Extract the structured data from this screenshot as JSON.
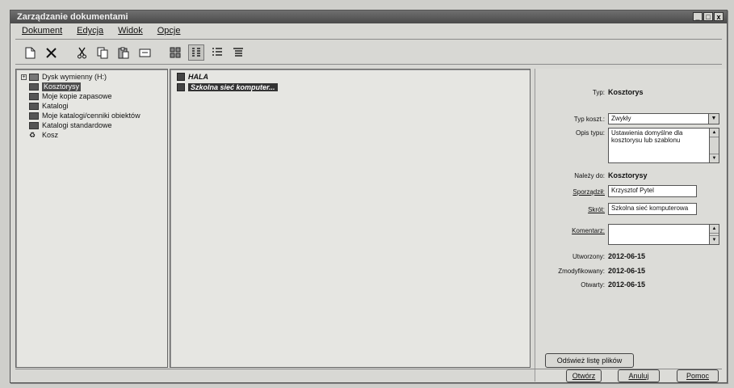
{
  "window": {
    "title": "Zarządzanie dokumentami",
    "min": "_",
    "max": "□",
    "close": "x"
  },
  "menu": [
    {
      "label": "Dokument"
    },
    {
      "label": "Edycja"
    },
    {
      "label": "Widok"
    },
    {
      "label": "Opcje"
    }
  ],
  "toolbar": {
    "icons": [
      "new-icon",
      "delete-icon",
      "cut-icon",
      "copy-icon",
      "paste-icon",
      "rename-icon",
      "large-icons-icon",
      "small-icons-icon",
      "list-view-icon",
      "details-view-icon"
    ]
  },
  "tree": [
    {
      "label": "Dysk wymienny (H:)",
      "expander": "+",
      "selected": false
    },
    {
      "label": "Kosztorysy",
      "selected": true
    },
    {
      "label": "Moje kopie zapasowe",
      "selected": false
    },
    {
      "label": "Katalogi",
      "selected": false
    },
    {
      "label": "Moje katalogi/cenniki obiektów",
      "selected": false
    },
    {
      "label": "Katalogi standardowe",
      "selected": false
    },
    {
      "label": "Kosz",
      "selected": false
    }
  ],
  "files": [
    {
      "label": "HALA",
      "selected": false
    },
    {
      "label": "Szkolna sieć komputer...",
      "selected": true
    }
  ],
  "props": {
    "typ_label": "Typ:",
    "typ_value": "Kosztorys",
    "typ_koszt_label": "Typ koszt.:",
    "typ_koszt_value": "Zwykły",
    "opis_label": "Opis typu:",
    "opis_value": "Ustawienia domyślne dla kosztorysu lub szablonu",
    "nalezy_label": "Należy do:",
    "nalezy_value": "Kosztorysy",
    "sporzadzil_label": "Sporządził:",
    "sporzadzil_value": "Krzysztof Pytel",
    "skrot_label": "Skrót:",
    "skrot_value": "Szkolna sieć komputerowa",
    "komentarz_label": "Komentarz:",
    "komentarz_value": "",
    "utworzony_label": "Utworzony:",
    "utworzony_value": "2012-06-15",
    "zmodyfikowany_label": "Zmodyfikowany:",
    "zmodyfikowany_value": "2012-06-15",
    "otwarty_label": "Otwarty:",
    "otwarty_value": "2012-06-15",
    "refresh_button": "Odśwież listę plików"
  },
  "buttons": {
    "open": "Otwórz",
    "cancel": "Anuluj",
    "help": "Pomoc"
  }
}
